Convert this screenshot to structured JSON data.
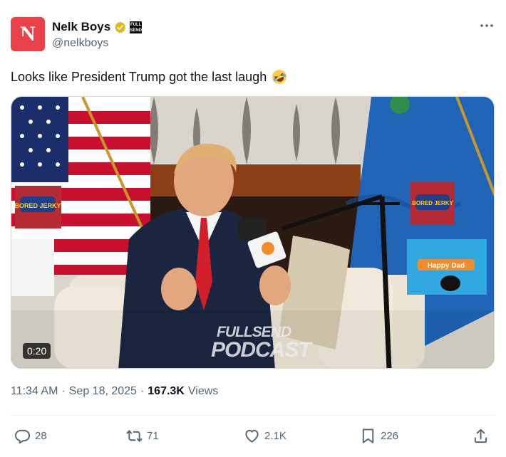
{
  "author": {
    "name": "Nelk Boys",
    "handle": "@nelkboys",
    "avatar_letter": "N",
    "avatar_color": "#e8414a",
    "verified_badge": "gold-verified-icon",
    "affiliate_badge_text": "FULL SEND"
  },
  "tweet": {
    "text": "Looks like President Trump got the last laugh",
    "emoji": "rolling-on-the-floor-laughing"
  },
  "video": {
    "duration": "0:20",
    "watermark_line1": "FULLSEND",
    "watermark_line2": "PODCAST",
    "prop_labels": {
      "jerky_brand": "BORED JERKY",
      "variety_pack": "Happy Dad"
    }
  },
  "meta": {
    "time": "11:34 AM",
    "separator": "·",
    "date": "Sep 18, 2025",
    "views_count": "167.3K",
    "views_label": "Views"
  },
  "actions": {
    "replies": "28",
    "reposts": "71",
    "likes": "2.1K",
    "bookmarks": "226"
  },
  "colors": {
    "text_primary": "#0f1419",
    "text_secondary": "#536471",
    "verified_gold": "#e2b719"
  }
}
